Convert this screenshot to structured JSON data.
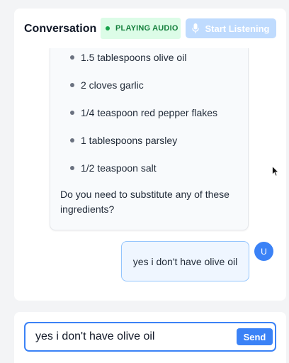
{
  "header": {
    "title": "Conversation",
    "status_badge": "PLAYING AUDIO",
    "listen_button": "Start Listening"
  },
  "messages": {
    "bot": {
      "ingredients": [
        "1.5 tablespoons olive oil",
        "2 cloves garlic",
        "1/4 teaspoon red pepper flakes",
        "1 tablespoons parsley",
        "1/2 teaspoon salt"
      ],
      "question": "Do you need to substitute any of these ingredients?"
    },
    "user": {
      "avatar_initial": "U",
      "text": "yes i don't have olive oil"
    }
  },
  "composer": {
    "input_value": "yes i don't have olive oil",
    "send_label": "Send"
  },
  "colors": {
    "accent": "#3b82f6",
    "badge_bg": "#dcfce7",
    "badge_text": "#15803d"
  },
  "icons": {
    "mic": "microphone-icon",
    "status": "status-dot-icon"
  }
}
